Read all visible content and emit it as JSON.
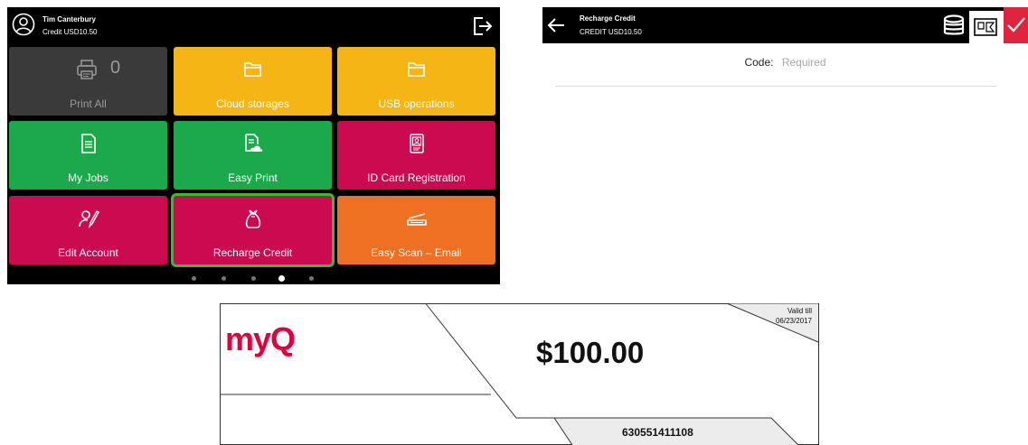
{
  "home": {
    "user_name": "Tim Canterbury",
    "credit_label": "Credit",
    "credit_value": "USD10.50",
    "tiles": [
      {
        "label": "Print All",
        "count": "0",
        "color": "#3a3a3a",
        "icon": "printer-icon"
      },
      {
        "label": "Cloud storages",
        "color": "#f5b515",
        "icon": "folder-icon"
      },
      {
        "label": "USB operations",
        "color": "#f5b515",
        "icon": "folder-icon"
      },
      {
        "label": "My Jobs",
        "color": "#1ba94c",
        "icon": "document-icon"
      },
      {
        "label": "Easy Print",
        "color": "#1ba94c",
        "icon": "cloud-document-icon"
      },
      {
        "label": "ID Card Registration",
        "color": "#cc0a4f",
        "icon": "id-card-icon"
      },
      {
        "label": "Edit Account",
        "color": "#cc0a4f",
        "icon": "edit-account-icon"
      },
      {
        "label": "Recharge Credit",
        "color": "#cc0a4f",
        "icon": "money-bag-icon"
      },
      {
        "label": "Easy Scan – Email",
        "color": "#ef7022",
        "icon": "scanner-icon"
      }
    ],
    "page_count": 5,
    "active_page": 4
  },
  "recharge": {
    "title": "Recharge Credit",
    "credit_line": "CREDIT USD10.50",
    "code_label": "Code:",
    "code_placeholder": "Required",
    "confirm_color": "#e0243d"
  },
  "voucher": {
    "brand": "myQ",
    "amount": "$100.00",
    "valid_label": "Valid till",
    "valid_date": "06/23/2017",
    "code": "630551411108"
  }
}
